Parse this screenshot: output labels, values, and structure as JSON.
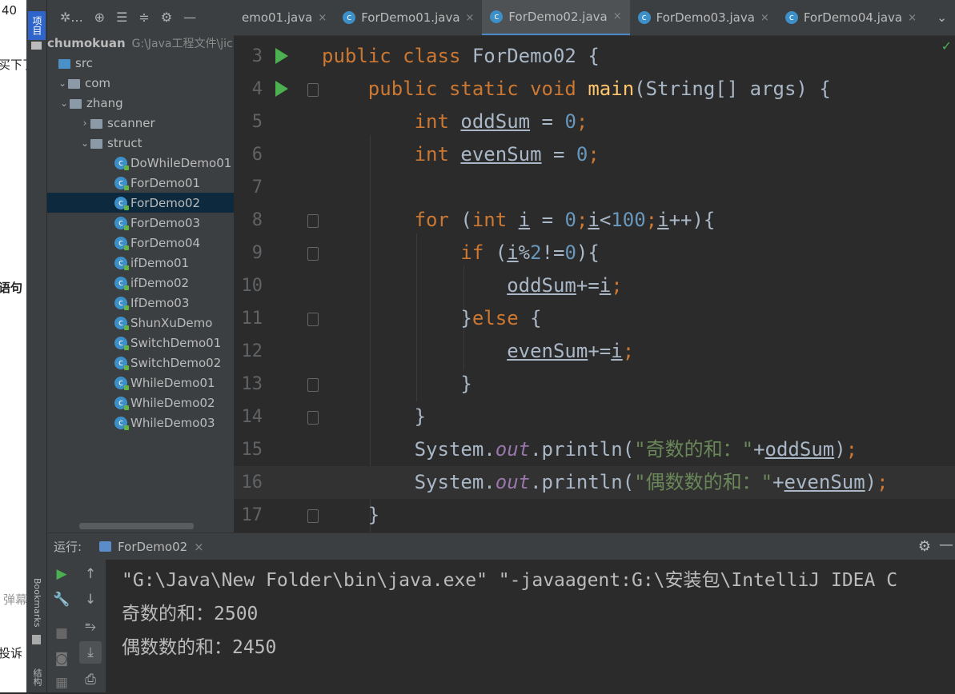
{
  "background_fragments": {
    "top": "40",
    "line2": "买下了",
    "line3": "语句",
    "line4": "弹幕",
    "line5": "投诉"
  },
  "left_toolwindow": {
    "project_tab": "项目",
    "bookmarks_tab": "Bookmarks",
    "structure_tab": "结构"
  },
  "project_panel": {
    "toolbar_dots": "...",
    "root": {
      "name": "chumokuan",
      "path": "G:\\Java工程文件\\jic"
    },
    "tree": [
      {
        "label": "src",
        "type": "folder",
        "depth": 0
      },
      {
        "label": "com",
        "type": "folder",
        "depth": 1
      },
      {
        "label": "zhang",
        "type": "folder",
        "depth": 2
      },
      {
        "label": "scanner",
        "type": "folder",
        "depth": 3
      },
      {
        "label": "struct",
        "type": "folder",
        "depth": 3
      },
      {
        "label": "DoWhileDemo01",
        "type": "class",
        "depth": 4
      },
      {
        "label": "ForDemo01",
        "type": "class",
        "depth": 4
      },
      {
        "label": "ForDemo02",
        "type": "class",
        "depth": 4,
        "selected": true
      },
      {
        "label": "ForDemo03",
        "type": "class",
        "depth": 4
      },
      {
        "label": "ForDemo04",
        "type": "class",
        "depth": 4
      },
      {
        "label": "ifDemo01",
        "type": "class",
        "depth": 4
      },
      {
        "label": "ifDemo02",
        "type": "class",
        "depth": 4
      },
      {
        "label": "IfDemo03",
        "type": "class",
        "depth": 4
      },
      {
        "label": "ShunXuDemo",
        "type": "class",
        "depth": 4
      },
      {
        "label": "SwitchDemo01",
        "type": "class",
        "depth": 4
      },
      {
        "label": "SwitchDemo02",
        "type": "class",
        "depth": 4
      },
      {
        "label": "WhileDemo01",
        "type": "class",
        "depth": 4
      },
      {
        "label": "WhileDemo02",
        "type": "class",
        "depth": 4
      },
      {
        "label": "WhileDemo03",
        "type": "class",
        "depth": 4
      }
    ]
  },
  "editor_tabs": [
    {
      "label": "emo01.java",
      "active": false,
      "icon": false
    },
    {
      "label": "ForDemo01.java",
      "active": false,
      "icon": true
    },
    {
      "label": "ForDemo02.java",
      "active": true,
      "icon": true
    },
    {
      "label": "ForDemo03.java",
      "active": false,
      "icon": true
    },
    {
      "label": "ForDemo04.java",
      "active": false,
      "icon": true
    }
  ],
  "editor": {
    "line_numbers": [
      "3",
      "4",
      "5",
      "6",
      "7",
      "8",
      "9",
      "10",
      "11",
      "12",
      "13",
      "14",
      "15",
      "16",
      "17"
    ],
    "current_line": "16"
  },
  "run_panel": {
    "label": "运行:",
    "tab": "ForDemo02",
    "output": [
      "\"G:\\Java\\New Folder\\bin\\java.exe\" \"-javaagent:G:\\安装包\\IntelliJ IDEA C",
      "奇数的和：2500",
      "偶数数的和：2450"
    ]
  },
  "colors": {
    "keyword": "#cc7832",
    "number": "#6897bb",
    "string": "#6a8759",
    "method": "#ffc66d",
    "field": "#9876aa",
    "text": "#a9b7c6"
  }
}
